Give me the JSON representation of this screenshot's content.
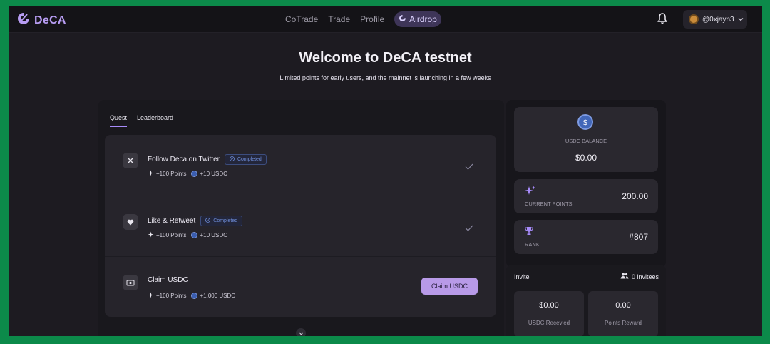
{
  "app": {
    "name": "DeCA"
  },
  "nav": {
    "links": [
      "CoTrade",
      "Trade",
      "Profile"
    ],
    "active": "Airdrop",
    "user": "@0xjayn3"
  },
  "hero": {
    "title": "Welcome to DeCA testnet",
    "subtitle": "Limited points for early users, and the mainnet is launching in a few weeks"
  },
  "tabs": [
    "Quest",
    "Leaderboard"
  ],
  "quests": [
    {
      "title": "Follow Deca on Twitter",
      "status": "Completed",
      "points": "+100 Points",
      "usdc": "+10 USDC",
      "icon": "x-logo-icon",
      "state": "done"
    },
    {
      "title": "Like & Retweet",
      "status": "Completed",
      "points": "+100 Points",
      "usdc": "+10 USDC",
      "icon": "heart-icon",
      "state": "done"
    },
    {
      "title": "Claim USDC",
      "status": "",
      "points": "+100 Points",
      "usdc": "+1,000 USDC",
      "icon": "cash-icon",
      "state": "claim",
      "action": "Claim USDC"
    }
  ],
  "balance": {
    "label": "USDC BALANCE",
    "value": "$0.00"
  },
  "points": {
    "label": "CURRENT POINTS",
    "value": "200.00"
  },
  "rank": {
    "label": "RANK",
    "value": "#807"
  },
  "invite": {
    "title": "Invite",
    "invitees": "0 invitees",
    "usdc_value": "$0.00",
    "usdc_label": "USDC Recevied",
    "points_value": "0.00",
    "points_label": "Points Reward"
  },
  "colors": {
    "accent": "#a78bfa",
    "badge": "#6f8edb",
    "claim": "#b89ae8",
    "frame": "#0c8a4a"
  }
}
